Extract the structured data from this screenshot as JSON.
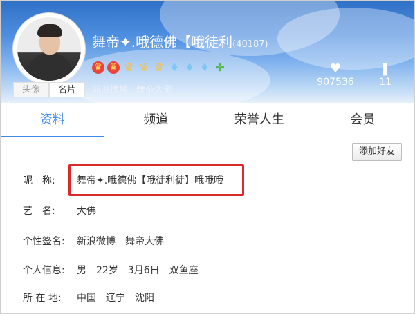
{
  "profile": {
    "nickname": "舞帝✦.哦德佛【哦徒利",
    "uid": "(40187)",
    "avatar_tabs": [
      "头像",
      "名片"
    ],
    "links": [
      "新浪微博",
      "舞帝大佛"
    ],
    "badges": [
      "crown-red-icon",
      "crown-red-icon",
      "crown-gold-icon",
      "crown-gold-icon",
      "crown-gold-icon",
      "diamond-icon",
      "diamond-icon",
      "diamond-icon",
      "leaf-icon"
    ],
    "likes": "907536",
    "fans": "11"
  },
  "tabs": [
    "资料",
    "频道",
    "荣誉人生",
    "会员"
  ],
  "actions": {
    "add_friend": "添加好友"
  },
  "info": {
    "nick": {
      "label": "昵　称:",
      "value": "舞帝✦.哦德佛【哦徒利徒】哦哦哦"
    },
    "art": {
      "label": "艺　名:",
      "value": "大佛"
    },
    "sign": {
      "label": "个性签名:",
      "value": "新浪微博　舞帝大佛"
    },
    "personal": {
      "label": "个人信息:",
      "value": "男　22岁　3月6日　双鱼座"
    },
    "location": {
      "label": "所 在 地:",
      "value": "中国　辽宁　沈阳"
    }
  },
  "colors": {
    "accent": "#3e8ae6",
    "highlight_box": "#d92b2b"
  }
}
